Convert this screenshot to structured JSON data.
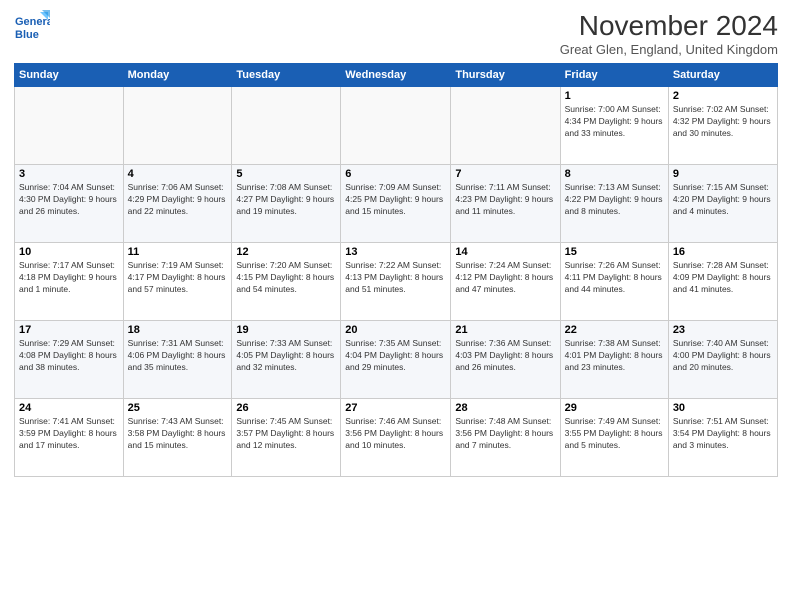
{
  "logo": {
    "line1": "General",
    "line2": "Blue"
  },
  "title": "November 2024",
  "subtitle": "Great Glen, England, United Kingdom",
  "weekdays": [
    "Sunday",
    "Monday",
    "Tuesday",
    "Wednesday",
    "Thursday",
    "Friday",
    "Saturday"
  ],
  "weeks": [
    [
      {
        "day": "",
        "info": ""
      },
      {
        "day": "",
        "info": ""
      },
      {
        "day": "",
        "info": ""
      },
      {
        "day": "",
        "info": ""
      },
      {
        "day": "",
        "info": ""
      },
      {
        "day": "1",
        "info": "Sunrise: 7:00 AM\nSunset: 4:34 PM\nDaylight: 9 hours and 33 minutes."
      },
      {
        "day": "2",
        "info": "Sunrise: 7:02 AM\nSunset: 4:32 PM\nDaylight: 9 hours and 30 minutes."
      }
    ],
    [
      {
        "day": "3",
        "info": "Sunrise: 7:04 AM\nSunset: 4:30 PM\nDaylight: 9 hours and 26 minutes."
      },
      {
        "day": "4",
        "info": "Sunrise: 7:06 AM\nSunset: 4:29 PM\nDaylight: 9 hours and 22 minutes."
      },
      {
        "day": "5",
        "info": "Sunrise: 7:08 AM\nSunset: 4:27 PM\nDaylight: 9 hours and 19 minutes."
      },
      {
        "day": "6",
        "info": "Sunrise: 7:09 AM\nSunset: 4:25 PM\nDaylight: 9 hours and 15 minutes."
      },
      {
        "day": "7",
        "info": "Sunrise: 7:11 AM\nSunset: 4:23 PM\nDaylight: 9 hours and 11 minutes."
      },
      {
        "day": "8",
        "info": "Sunrise: 7:13 AM\nSunset: 4:22 PM\nDaylight: 9 hours and 8 minutes."
      },
      {
        "day": "9",
        "info": "Sunrise: 7:15 AM\nSunset: 4:20 PM\nDaylight: 9 hours and 4 minutes."
      }
    ],
    [
      {
        "day": "10",
        "info": "Sunrise: 7:17 AM\nSunset: 4:18 PM\nDaylight: 9 hours and 1 minute."
      },
      {
        "day": "11",
        "info": "Sunrise: 7:19 AM\nSunset: 4:17 PM\nDaylight: 8 hours and 57 minutes."
      },
      {
        "day": "12",
        "info": "Sunrise: 7:20 AM\nSunset: 4:15 PM\nDaylight: 8 hours and 54 minutes."
      },
      {
        "day": "13",
        "info": "Sunrise: 7:22 AM\nSunset: 4:13 PM\nDaylight: 8 hours and 51 minutes."
      },
      {
        "day": "14",
        "info": "Sunrise: 7:24 AM\nSunset: 4:12 PM\nDaylight: 8 hours and 47 minutes."
      },
      {
        "day": "15",
        "info": "Sunrise: 7:26 AM\nSunset: 4:11 PM\nDaylight: 8 hours and 44 minutes."
      },
      {
        "day": "16",
        "info": "Sunrise: 7:28 AM\nSunset: 4:09 PM\nDaylight: 8 hours and 41 minutes."
      }
    ],
    [
      {
        "day": "17",
        "info": "Sunrise: 7:29 AM\nSunset: 4:08 PM\nDaylight: 8 hours and 38 minutes."
      },
      {
        "day": "18",
        "info": "Sunrise: 7:31 AM\nSunset: 4:06 PM\nDaylight: 8 hours and 35 minutes."
      },
      {
        "day": "19",
        "info": "Sunrise: 7:33 AM\nSunset: 4:05 PM\nDaylight: 8 hours and 32 minutes."
      },
      {
        "day": "20",
        "info": "Sunrise: 7:35 AM\nSunset: 4:04 PM\nDaylight: 8 hours and 29 minutes."
      },
      {
        "day": "21",
        "info": "Sunrise: 7:36 AM\nSunset: 4:03 PM\nDaylight: 8 hours and 26 minutes."
      },
      {
        "day": "22",
        "info": "Sunrise: 7:38 AM\nSunset: 4:01 PM\nDaylight: 8 hours and 23 minutes."
      },
      {
        "day": "23",
        "info": "Sunrise: 7:40 AM\nSunset: 4:00 PM\nDaylight: 8 hours and 20 minutes."
      }
    ],
    [
      {
        "day": "24",
        "info": "Sunrise: 7:41 AM\nSunset: 3:59 PM\nDaylight: 8 hours and 17 minutes."
      },
      {
        "day": "25",
        "info": "Sunrise: 7:43 AM\nSunset: 3:58 PM\nDaylight: 8 hours and 15 minutes."
      },
      {
        "day": "26",
        "info": "Sunrise: 7:45 AM\nSunset: 3:57 PM\nDaylight: 8 hours and 12 minutes."
      },
      {
        "day": "27",
        "info": "Sunrise: 7:46 AM\nSunset: 3:56 PM\nDaylight: 8 hours and 10 minutes."
      },
      {
        "day": "28",
        "info": "Sunrise: 7:48 AM\nSunset: 3:56 PM\nDaylight: 8 hours and 7 minutes."
      },
      {
        "day": "29",
        "info": "Sunrise: 7:49 AM\nSunset: 3:55 PM\nDaylight: 8 hours and 5 minutes."
      },
      {
        "day": "30",
        "info": "Sunrise: 7:51 AM\nSunset: 3:54 PM\nDaylight: 8 hours and 3 minutes."
      }
    ]
  ]
}
